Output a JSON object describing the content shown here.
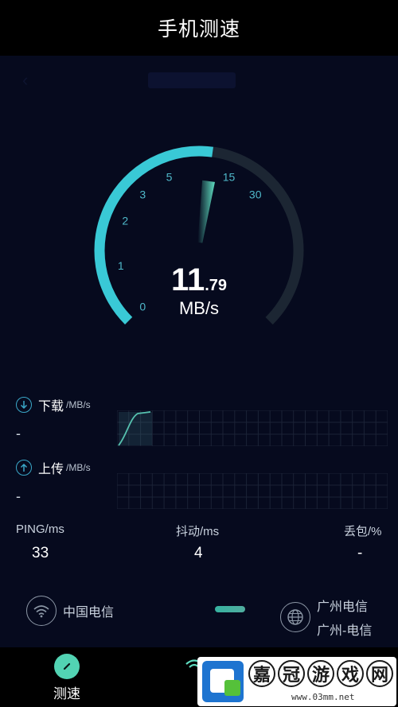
{
  "header": {
    "title": "手机测速"
  },
  "gauge": {
    "current_value": 11.79,
    "value_integer": "11",
    "value_decimal": ".79",
    "unit": "MB/s",
    "tick_labels": [
      "0",
      "1",
      "2",
      "3",
      "5",
      "15",
      "30"
    ],
    "colors": {
      "active": "#39c9d6",
      "inactive": "#1c2633",
      "needle": "#5fdcc0"
    }
  },
  "download": {
    "label": "下载",
    "unit": "/MB/s",
    "value": "-"
  },
  "upload": {
    "label": "上传",
    "unit": "/MB/s",
    "value": "-"
  },
  "stats": {
    "ping": {
      "label": "PING/ms",
      "value": "33"
    },
    "jitter": {
      "label": "抖动/ms",
      "value": "4"
    },
    "loss": {
      "label": "丢包/%",
      "value": "-"
    }
  },
  "isp": {
    "left": {
      "name": "中国电信",
      "icon": "wifi-icon"
    },
    "right": {
      "line1": "广州电信",
      "line2": "广州-电信",
      "icon": "globe-icon"
    }
  },
  "tabbar": {
    "items": [
      {
        "label": "测速",
        "icon": "speedometer-icon",
        "active": true
      }
    ]
  },
  "watermark": {
    "chars": [
      "嘉",
      "冠",
      "游",
      "戏",
      "网"
    ],
    "url": "www.03mm.net"
  }
}
